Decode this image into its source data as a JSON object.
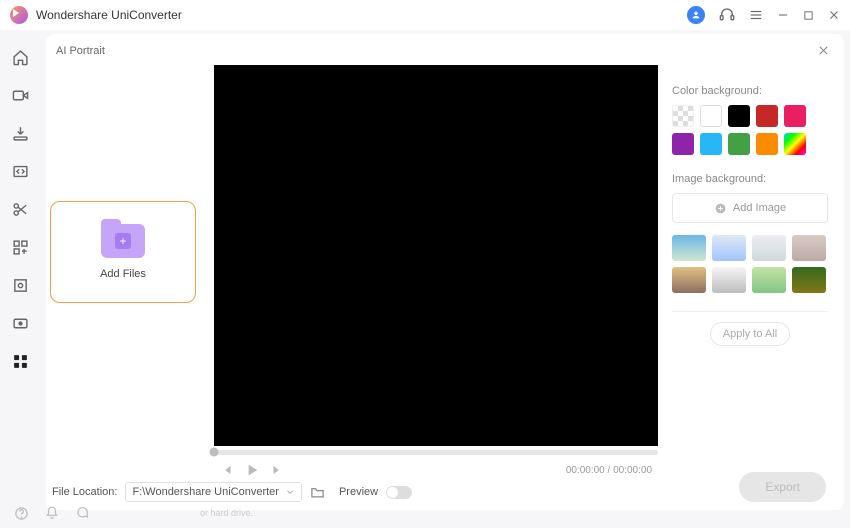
{
  "app": {
    "name": "Wondershare UniConverter"
  },
  "panel": {
    "title": "AI Portrait"
  },
  "add_tile": {
    "label": "Add Files"
  },
  "transport": {
    "time": "00:00:00 / 00:00:00"
  },
  "right": {
    "color_bg_label": "Color background:",
    "image_bg_label": "Image background:",
    "add_image_label": "Add Image",
    "colors": [
      "checker",
      "#ffffff",
      "#000000",
      "#c62828",
      "#e91e63",
      "#8e24aa",
      "#29b6f6",
      "#43a047",
      "#fb8c00",
      "rainbow"
    ],
    "thumbs": [
      "linear-gradient(#6ab7e6,#cfe6d2)",
      "linear-gradient(#dfe9f3,#a1c4fd)",
      "linear-gradient(#eceff1,#cfd8dc)",
      "linear-gradient(#d7ccc8,#bcaaa4)",
      "linear-gradient(#e0c080,#8d6e63)",
      "linear-gradient(#f5f5f5,#bdbdbd)",
      "linear-gradient(#c5e1a5,#81c784)",
      "linear-gradient(#33691e,#827717)"
    ],
    "apply_all_label": "Apply to All",
    "export_label": "Export"
  },
  "footer": {
    "location_label": "File Location:",
    "location_value": "F:\\Wondershare UniConverter",
    "preview_label": "Preview"
  },
  "bottom_snippets": [
    "or hard drive.",
    "",
    ""
  ]
}
